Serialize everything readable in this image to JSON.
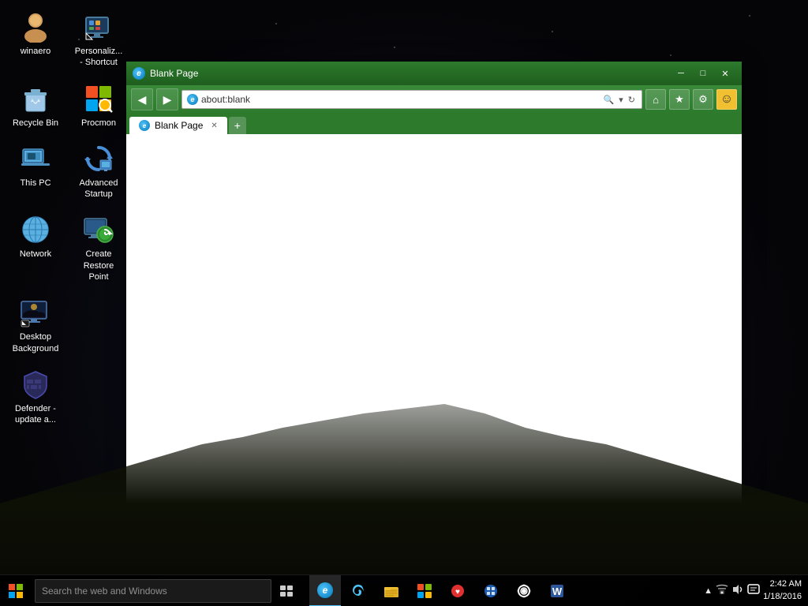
{
  "desktop": {
    "title": "Windows 10 Desktop"
  },
  "icons": [
    {
      "id": "winaero",
      "label": "winaero",
      "type": "person",
      "row": 0,
      "col": 0
    },
    {
      "id": "personalize",
      "label": "Personaliz... - Shortcut",
      "type": "monitor",
      "row": 0,
      "col": 1
    },
    {
      "id": "recycle-bin",
      "label": "Recycle Bin",
      "type": "recycle",
      "row": 1,
      "col": 0
    },
    {
      "id": "procmon",
      "label": "Procmon",
      "type": "procmon",
      "row": 1,
      "col": 1
    },
    {
      "id": "this-pc",
      "label": "This PC",
      "type": "computer",
      "row": 2,
      "col": 0
    },
    {
      "id": "advanced-startup",
      "label": "Advanced Startup",
      "type": "refresh",
      "row": 2,
      "col": 1
    },
    {
      "id": "network",
      "label": "Network",
      "type": "network",
      "row": 3,
      "col": 0
    },
    {
      "id": "restore-point",
      "label": "Create Restore Point",
      "type": "restore",
      "row": 3,
      "col": 1
    },
    {
      "id": "desktop-bg",
      "label": "Desktop Background",
      "type": "desktop-bg",
      "row": 4,
      "col": 0
    },
    {
      "id": "defender",
      "label": "Defender - update a...",
      "type": "defender",
      "row": 5,
      "col": 0
    }
  ],
  "browser": {
    "title": "Blank Page",
    "url": "about:blank",
    "tab_label": "Blank Page",
    "toolbar": {
      "back": "◀",
      "forward": "▶",
      "refresh": "↻",
      "home": "⌂",
      "favorites": "★",
      "tools": "⚙",
      "smiley": "☺"
    },
    "window_controls": {
      "minimize": "─",
      "maximize": "□",
      "close": "✕"
    }
  },
  "taskbar": {
    "search_placeholder": "Search the web and Windows",
    "clock": {
      "time": "2:42 AM",
      "date": "1/18/2016"
    }
  }
}
